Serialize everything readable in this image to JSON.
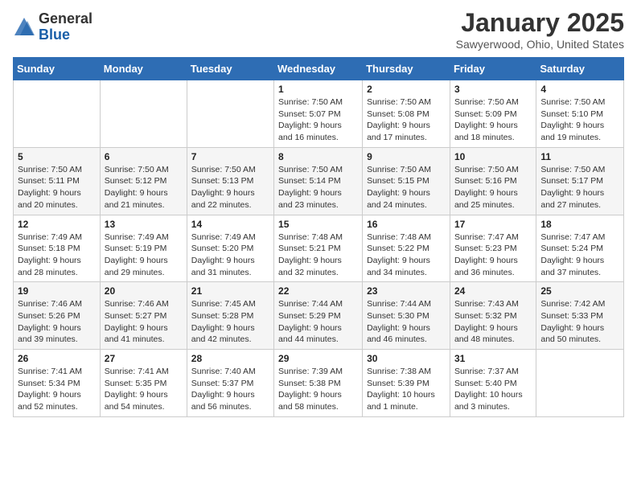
{
  "header": {
    "logo_general": "General",
    "logo_blue": "Blue",
    "month_title": "January 2025",
    "location": "Sawyerwood, Ohio, United States"
  },
  "weekdays": [
    "Sunday",
    "Monday",
    "Tuesday",
    "Wednesday",
    "Thursday",
    "Friday",
    "Saturday"
  ],
  "weeks": [
    [
      {
        "day": "",
        "info": ""
      },
      {
        "day": "",
        "info": ""
      },
      {
        "day": "",
        "info": ""
      },
      {
        "day": "1",
        "info": "Sunrise: 7:50 AM\nSunset: 5:07 PM\nDaylight: 9 hours\nand 16 minutes."
      },
      {
        "day": "2",
        "info": "Sunrise: 7:50 AM\nSunset: 5:08 PM\nDaylight: 9 hours\nand 17 minutes."
      },
      {
        "day": "3",
        "info": "Sunrise: 7:50 AM\nSunset: 5:09 PM\nDaylight: 9 hours\nand 18 minutes."
      },
      {
        "day": "4",
        "info": "Sunrise: 7:50 AM\nSunset: 5:10 PM\nDaylight: 9 hours\nand 19 minutes."
      }
    ],
    [
      {
        "day": "5",
        "info": "Sunrise: 7:50 AM\nSunset: 5:11 PM\nDaylight: 9 hours\nand 20 minutes."
      },
      {
        "day": "6",
        "info": "Sunrise: 7:50 AM\nSunset: 5:12 PM\nDaylight: 9 hours\nand 21 minutes."
      },
      {
        "day": "7",
        "info": "Sunrise: 7:50 AM\nSunset: 5:13 PM\nDaylight: 9 hours\nand 22 minutes."
      },
      {
        "day": "8",
        "info": "Sunrise: 7:50 AM\nSunset: 5:14 PM\nDaylight: 9 hours\nand 23 minutes."
      },
      {
        "day": "9",
        "info": "Sunrise: 7:50 AM\nSunset: 5:15 PM\nDaylight: 9 hours\nand 24 minutes."
      },
      {
        "day": "10",
        "info": "Sunrise: 7:50 AM\nSunset: 5:16 PM\nDaylight: 9 hours\nand 25 minutes."
      },
      {
        "day": "11",
        "info": "Sunrise: 7:50 AM\nSunset: 5:17 PM\nDaylight: 9 hours\nand 27 minutes."
      }
    ],
    [
      {
        "day": "12",
        "info": "Sunrise: 7:49 AM\nSunset: 5:18 PM\nDaylight: 9 hours\nand 28 minutes."
      },
      {
        "day": "13",
        "info": "Sunrise: 7:49 AM\nSunset: 5:19 PM\nDaylight: 9 hours\nand 29 minutes."
      },
      {
        "day": "14",
        "info": "Sunrise: 7:49 AM\nSunset: 5:20 PM\nDaylight: 9 hours\nand 31 minutes."
      },
      {
        "day": "15",
        "info": "Sunrise: 7:48 AM\nSunset: 5:21 PM\nDaylight: 9 hours\nand 32 minutes."
      },
      {
        "day": "16",
        "info": "Sunrise: 7:48 AM\nSunset: 5:22 PM\nDaylight: 9 hours\nand 34 minutes."
      },
      {
        "day": "17",
        "info": "Sunrise: 7:47 AM\nSunset: 5:23 PM\nDaylight: 9 hours\nand 36 minutes."
      },
      {
        "day": "18",
        "info": "Sunrise: 7:47 AM\nSunset: 5:24 PM\nDaylight: 9 hours\nand 37 minutes."
      }
    ],
    [
      {
        "day": "19",
        "info": "Sunrise: 7:46 AM\nSunset: 5:26 PM\nDaylight: 9 hours\nand 39 minutes."
      },
      {
        "day": "20",
        "info": "Sunrise: 7:46 AM\nSunset: 5:27 PM\nDaylight: 9 hours\nand 41 minutes."
      },
      {
        "day": "21",
        "info": "Sunrise: 7:45 AM\nSunset: 5:28 PM\nDaylight: 9 hours\nand 42 minutes."
      },
      {
        "day": "22",
        "info": "Sunrise: 7:44 AM\nSunset: 5:29 PM\nDaylight: 9 hours\nand 44 minutes."
      },
      {
        "day": "23",
        "info": "Sunrise: 7:44 AM\nSunset: 5:30 PM\nDaylight: 9 hours\nand 46 minutes."
      },
      {
        "day": "24",
        "info": "Sunrise: 7:43 AM\nSunset: 5:32 PM\nDaylight: 9 hours\nand 48 minutes."
      },
      {
        "day": "25",
        "info": "Sunrise: 7:42 AM\nSunset: 5:33 PM\nDaylight: 9 hours\nand 50 minutes."
      }
    ],
    [
      {
        "day": "26",
        "info": "Sunrise: 7:41 AM\nSunset: 5:34 PM\nDaylight: 9 hours\nand 52 minutes."
      },
      {
        "day": "27",
        "info": "Sunrise: 7:41 AM\nSunset: 5:35 PM\nDaylight: 9 hours\nand 54 minutes."
      },
      {
        "day": "28",
        "info": "Sunrise: 7:40 AM\nSunset: 5:37 PM\nDaylight: 9 hours\nand 56 minutes."
      },
      {
        "day": "29",
        "info": "Sunrise: 7:39 AM\nSunset: 5:38 PM\nDaylight: 9 hours\nand 58 minutes."
      },
      {
        "day": "30",
        "info": "Sunrise: 7:38 AM\nSunset: 5:39 PM\nDaylight: 10 hours\nand 1 minute."
      },
      {
        "day": "31",
        "info": "Sunrise: 7:37 AM\nSunset: 5:40 PM\nDaylight: 10 hours\nand 3 minutes."
      },
      {
        "day": "",
        "info": ""
      }
    ]
  ]
}
